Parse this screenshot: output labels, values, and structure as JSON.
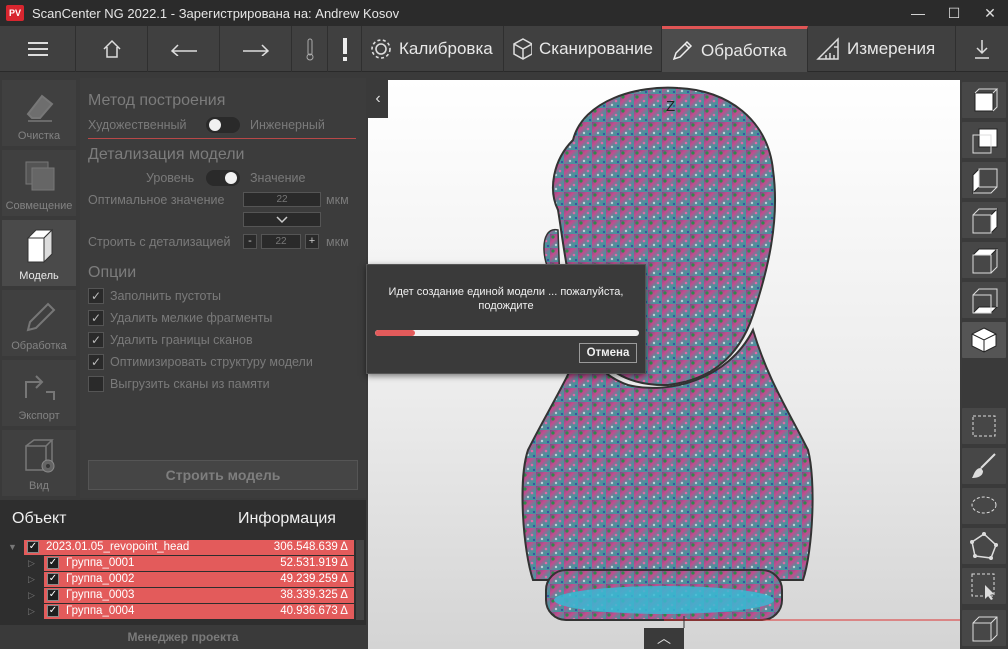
{
  "window": {
    "logo": "PV",
    "title": "ScanCenter NG 2022.1 - Зарегистрирована на: Andrew Kosov",
    "minimize": "—",
    "maximize": "☐",
    "close": "✕"
  },
  "toolbar": {
    "tabs": [
      {
        "label": "Калибровка",
        "icon": "gear-icon"
      },
      {
        "label": "Сканирование",
        "icon": "cube-icon"
      },
      {
        "label": "Обработка",
        "icon": "pencil-icon"
      },
      {
        "label": "Измерения",
        "icon": "ruler-icon"
      }
    ],
    "active_tab": "Обработка",
    "accent": "#e05555"
  },
  "left_tools": [
    {
      "label": "Очистка",
      "icon": "eraser-icon"
    },
    {
      "label": "Совмещение",
      "icon": "layers-icon"
    },
    {
      "label": "Модель",
      "icon": "cube-icon"
    },
    {
      "label": "Обработка",
      "icon": "pencil-icon"
    },
    {
      "label": "Экспорт",
      "icon": "export-icon"
    },
    {
      "label": "Вид",
      "icon": "eye-icon"
    }
  ],
  "panel": {
    "method_title": "Метод построения",
    "method_left": "Художественный",
    "method_right": "Инженерный",
    "detail_title": "Детализация модели",
    "detail_left": "Уровень",
    "detail_right": "Значение",
    "optimal_label": "Оптимальное значение",
    "optimal_value": "22",
    "unit": "мкм",
    "build_with_label": "Строить с детализацией",
    "build_with_value": "22",
    "minus": "-",
    "plus": "+",
    "options_title": "Опции",
    "options": [
      {
        "label": "Заполнить пустоты",
        "checked": true
      },
      {
        "label": "Удалить мелкие фрагменты",
        "checked": true
      },
      {
        "label": "Удалить границы сканов",
        "checked": true
      },
      {
        "label": "Оптимизировать структуру модели",
        "checked": true
      },
      {
        "label": "Выгрузить сканы из памяти",
        "checked": false
      }
    ],
    "build_button": "Строить модель"
  },
  "objects": {
    "header_object": "Объект",
    "header_info": "Информация",
    "root": {
      "name": "2023.01.05_revopoint_head",
      "value": "306.548.639 Δ"
    },
    "groups": [
      {
        "name": "Группа_0001",
        "value": "52.531.919 Δ"
      },
      {
        "name": "Группа_0002",
        "value": "49.239.259 Δ"
      },
      {
        "name": "Группа_0003",
        "value": "38.339.325 Δ"
      },
      {
        "name": "Группа_0004",
        "value": "40.936.673 Δ"
      }
    ],
    "manager_button": "Менеджер проекта"
  },
  "viewport": {
    "axis_label": "Z",
    "collapse": "‹",
    "expand": "︿"
  },
  "dialog": {
    "message": "Идет создание единой модели ... пожалуйста, подождите",
    "progress": 0.15,
    "cancel": "Отмена"
  }
}
